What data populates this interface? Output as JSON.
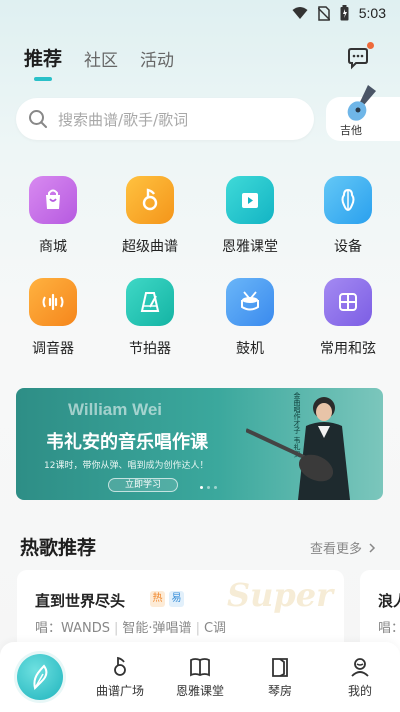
{
  "status_bar": {
    "time": "5:03"
  },
  "tabs": [
    {
      "label": "推荐"
    },
    {
      "label": "社区"
    },
    {
      "label": "活动"
    }
  ],
  "search": {
    "placeholder": "搜索曲谱/歌手/歌词"
  },
  "instrument": {
    "label": "吉他"
  },
  "grid": [
    {
      "label": "商城",
      "icon": "shopping-bag-icon"
    },
    {
      "label": "超级曲谱",
      "icon": "music-note-icon"
    },
    {
      "label": "恩雅课堂",
      "icon": "video-play-icon"
    },
    {
      "label": "设备",
      "icon": "guitar-device-icon"
    },
    {
      "label": "调音器",
      "icon": "tuner-icon"
    },
    {
      "label": "节拍器",
      "icon": "metronome-icon"
    },
    {
      "label": "鼓机",
      "icon": "drum-icon"
    },
    {
      "label": "常用和弦",
      "icon": "chord-grid-icon"
    }
  ],
  "banner": {
    "name": "William Wei",
    "title": "韦礼安的音乐唱作课",
    "subtitle": "12课时，带你从弹、唱到成为创作达人！",
    "cta": "立即学习",
    "vertical_text": "金曲唱作才子 韦礼安"
  },
  "hot_songs": {
    "title": "热歌推荐",
    "more": "查看更多",
    "items": [
      {
        "name": "直到世界尽头",
        "tag_hot": "热",
        "tag_easy": "易",
        "singer": "唱：WANDS",
        "type": "智能·弹唱谱",
        "key": "C调",
        "watermark": "Super"
      },
      {
        "name": "浪人",
        "singer": "唱："
      }
    ]
  },
  "nav": [
    {
      "label": "曲谱广场"
    },
    {
      "label": "恩雅课堂"
    },
    {
      "label": "琴房"
    },
    {
      "label": "我的"
    }
  ],
  "colors": {
    "accent": "#2ac0c8",
    "shop": "#c56be8",
    "score": "#f7a826",
    "class": "#20c3c9",
    "device": "#3eb1f0",
    "tuner": "#f79a28",
    "metronome": "#20c3b0",
    "drum": "#4a9ff0",
    "chord": "#8a6ee8"
  }
}
